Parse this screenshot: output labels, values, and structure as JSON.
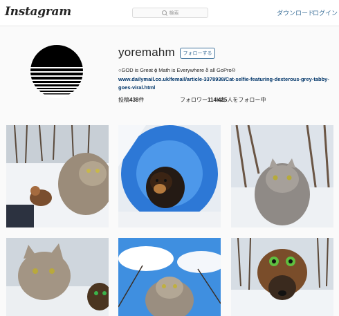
{
  "header": {
    "logo": "Instagram",
    "search_placeholder": "検索",
    "download_link": "ダウンロード",
    "login_link": "ログイン"
  },
  "profile": {
    "username": "yoremahm",
    "follow_button": "フォローする",
    "bio": "○GOD is Great ɸ Math is Everywhere δ all GoPro®",
    "link": "www.dailymail.co.uk/femail/article-3378938/Cat-selfie-featuring-dexterous-grey-tabby-goes-viral.html",
    "stats": {
      "posts_label": "投稿",
      "posts_count": "438",
      "posts_unit": "件",
      "followers_label": "フォロワー",
      "followers_count": "114k",
      "followers_unit": "人",
      "following_count": "425",
      "following_label": "人をフォロー中"
    }
  },
  "posts": [
    {
      "subject": "cat-selfie-snow-with-dog"
    },
    {
      "subject": "dog-fisheye-sky"
    },
    {
      "subject": "cat-selfie-forest-snow"
    },
    {
      "subject": "cat-selfie-with-dog"
    },
    {
      "subject": "cat-selfie-sky-clouds"
    },
    {
      "subject": "dog-in-costume-snow"
    }
  ],
  "colors": {
    "link_blue": "#3f729b",
    "bio_link": "#003569",
    "border": "#e6e6e6"
  }
}
